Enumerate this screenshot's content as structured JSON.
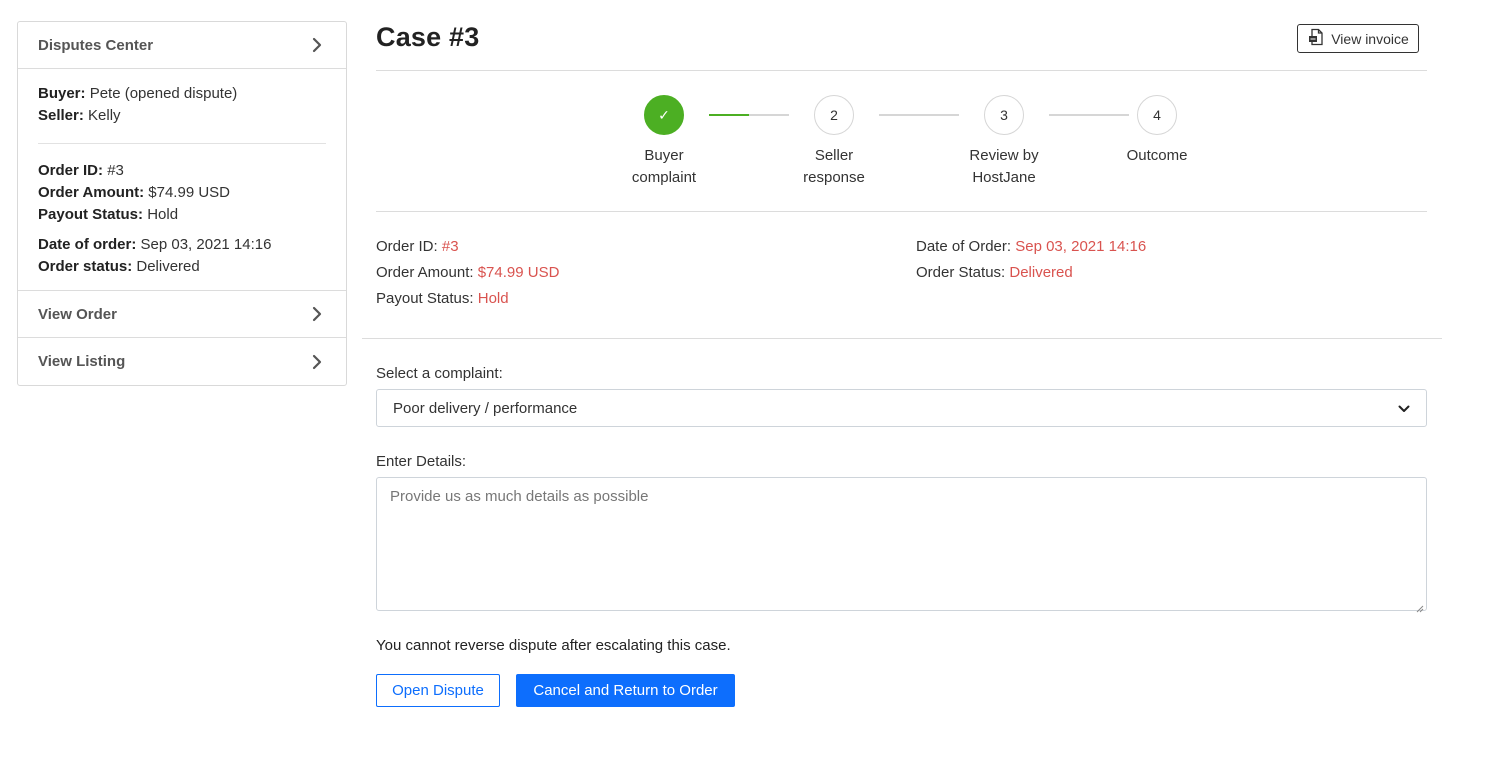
{
  "sidebar": {
    "header": "Disputes Center",
    "buyer_label": "Buyer:",
    "buyer_value": "Pete (opened dispute)",
    "seller_label": "Seller:",
    "seller_value": "Kelly",
    "order_id_label": "Order ID:",
    "order_id_value": "#3",
    "order_amount_label": "Order Amount:",
    "order_amount_value": "$74.99 USD",
    "payout_label": "Payout Status:",
    "payout_value": "Hold",
    "date_label": "Date of order:",
    "date_value": "Sep 03, 2021 14:16",
    "status_label": "Order status:",
    "status_value": "Delivered",
    "view_order": "View Order",
    "view_listing": "View Listing"
  },
  "header": {
    "title": "Case #3",
    "invoice_button": "View invoice"
  },
  "stepper": {
    "steps": [
      {
        "number": "✓",
        "line1": "Buyer",
        "line2": "complaint",
        "done": true
      },
      {
        "number": "2",
        "line1": "Seller",
        "line2": "response",
        "done": false
      },
      {
        "number": "3",
        "line1": "Review by",
        "line2": "HostJane",
        "done": false
      },
      {
        "number": "4",
        "line1": "Outcome",
        "line2": "",
        "done": false
      }
    ],
    "progress_fraction_first_connector": 0.5,
    "accent_color": "#4caf23"
  },
  "order_info": {
    "order_id_label": "Order ID:",
    "order_id_value": "#3",
    "order_amount_label": "Order Amount:",
    "order_amount_value": "$74.99 USD",
    "payout_label": "Payout Status:",
    "payout_value": "Hold",
    "date_label": "Date of Order:",
    "date_value": "Sep 03, 2021 14:16",
    "status_label": "Order Status:",
    "status_value": "Delivered",
    "value_color": "#d9534f"
  },
  "form": {
    "complaint_label": "Select a complaint:",
    "complaint_selected": "Poor delivery / performance",
    "details_label": "Enter Details:",
    "details_placeholder": "Provide us as much details as possible",
    "warning": "You cannot reverse dispute after escalating this case.",
    "open_dispute_button": "Open Dispute",
    "cancel_button": "Cancel and Return to Order",
    "primary_color": "#0d6efd"
  }
}
